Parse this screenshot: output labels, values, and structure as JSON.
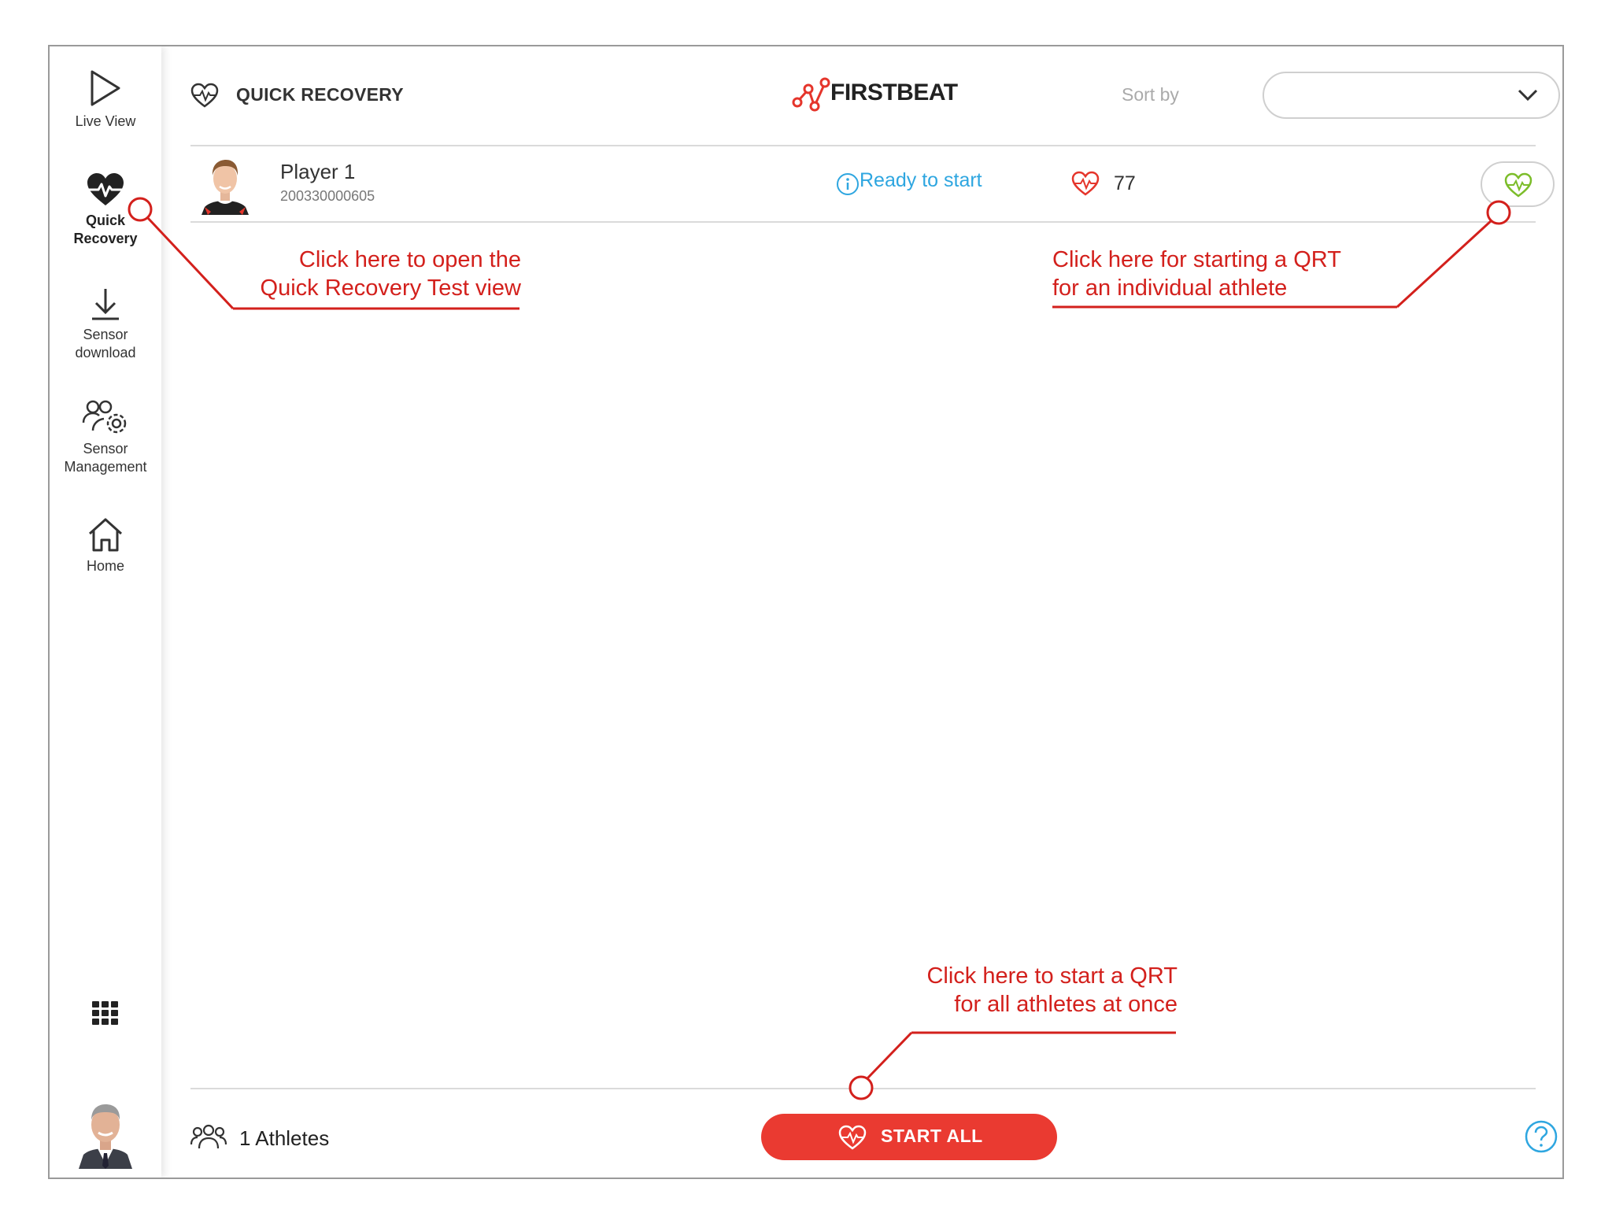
{
  "sidebar": {
    "items": [
      {
        "label": "Live View",
        "icon": "play-icon"
      },
      {
        "label": "Quick\nRecovery",
        "icon": "heart-pulse-icon",
        "active": true
      },
      {
        "label": "Sensor\ndownload",
        "icon": "download-icon"
      },
      {
        "label": "Sensor\nManagement",
        "icon": "users-gear-icon"
      },
      {
        "label": "Home",
        "icon": "home-icon"
      }
    ],
    "apps_icon": "grid-icon",
    "avatar": "user-avatar"
  },
  "header": {
    "title": "QUICK RECOVERY",
    "logo_text": "FIRSTBEAT",
    "sort_label": "Sort by",
    "sort_value": ""
  },
  "players": [
    {
      "name": "Player 1",
      "id": "200330000605",
      "status": "Ready to start",
      "heart_rate": "77"
    }
  ],
  "footer": {
    "athletes_count": "1 Athletes",
    "start_all_label": "START ALL"
  },
  "annotations": {
    "open_view": "Click here to open the\nQuick Recovery Test view",
    "individual_qrt": "Click here for starting a QRT\nfor an individual athlete",
    "start_all": "Click here to start a QRT\nfor all athletes at once"
  },
  "colors": {
    "accent_red": "#ea3a31",
    "annotation_red": "#d3201c",
    "status_blue": "#2ea6e0",
    "qrt_green": "#7cbd2a"
  }
}
